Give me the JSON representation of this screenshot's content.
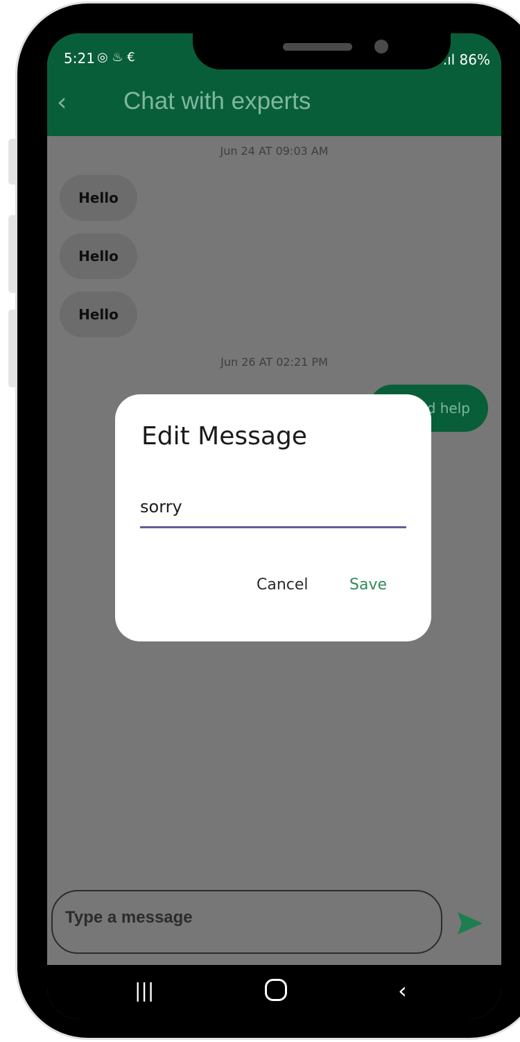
{
  "status_bar": {
    "time": "5:21",
    "left_icons": "◎ ♨ €",
    "right": "ᯤ.ıl 86%"
  },
  "app_bar": {
    "back_icon": "chevron-left-icon",
    "title": "Chat with experts"
  },
  "chat": {
    "date1": "Jun 24 AT 09:03 AM",
    "messages_in": [
      "Hello",
      "Hello",
      "Hello"
    ],
    "date2": "Jun 26 AT 02:21 PM",
    "message_out": "d help"
  },
  "composer": {
    "placeholder": "Type a message",
    "send_icon": "send-icon"
  },
  "dialog": {
    "title": "Edit Message",
    "value": "sorry",
    "cancel_label": "Cancel",
    "save_label": "Save"
  },
  "nav": {
    "recent_icon": "recents-icon",
    "home_icon": "home-icon",
    "back_icon": "back-icon"
  },
  "colors": {
    "accent": "#095e3a",
    "save": "#2e8b57"
  }
}
